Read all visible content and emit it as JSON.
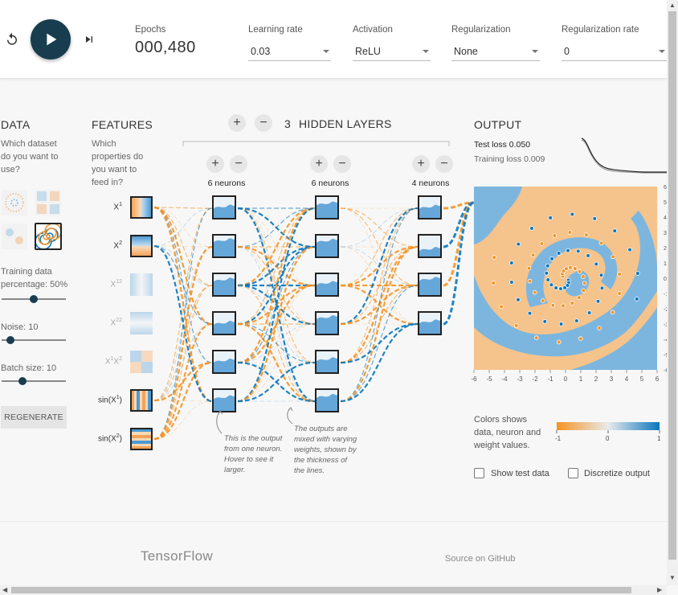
{
  "topbar": {
    "epochs_label": "Epochs",
    "epochs_value": "000,480",
    "learning_rate": {
      "label": "Learning rate",
      "value": "0.03"
    },
    "activation": {
      "label": "Activation",
      "value": "ReLU"
    },
    "regularization": {
      "label": "Regularization",
      "value": "None"
    },
    "regularization_rate": {
      "label": "Regularization rate",
      "value": "0"
    }
  },
  "data_panel": {
    "title": "DATA",
    "question": [
      "Which dataset",
      "do you want to",
      "use?"
    ],
    "training_ratio_label": "Training data",
    "training_ratio_value_label": "percentage:  50%",
    "training_ratio": 0.5,
    "noise_label": "Noise:  10",
    "noise": 0.2,
    "batch_label": "Batch size:  10",
    "batch": 0.3,
    "regenerate_label": "REGENERATE"
  },
  "features": {
    "title": "FEATURES",
    "question": [
      "Which",
      "properties do",
      "you want to",
      "feed in?"
    ],
    "items": [
      {
        "label": "X",
        "sup": "1",
        "active": true
      },
      {
        "label": "X",
        "sup": "2",
        "active": true
      },
      {
        "label": "X",
        "sup": "12",
        "active": false
      },
      {
        "label": "X",
        "sup": "22",
        "active": false
      },
      {
        "label": "X",
        "sup": "1",
        "label2": "X",
        "sup2": "2",
        "active": false
      },
      {
        "label": "sin(X",
        "sup": "1",
        "suffix": ")",
        "active": true
      },
      {
        "label": "sin(X",
        "sup": "2",
        "suffix": ")",
        "active": true
      }
    ]
  },
  "network": {
    "layer_count": "3",
    "hidden_layers_label": "HIDDEN LAYERS",
    "layers": [
      {
        "neurons_label": "6 neurons",
        "count": 6
      },
      {
        "neurons_label": "6 neurons",
        "count": 6
      },
      {
        "neurons_label": "4 neurons",
        "count": 4
      }
    ],
    "annotation_1": [
      "This is the output",
      "from one neuron.",
      "Hover to see it",
      "larger."
    ],
    "annotation_2": [
      "The outputs are",
      "mixed with varying",
      "weights, shown by",
      "the thickness of",
      "the lines."
    ]
  },
  "output": {
    "title": "OUTPUT",
    "test_loss_label": "Test loss",
    "test_loss": "0.050",
    "training_loss_label": "Training loss",
    "training_loss": "0.009",
    "x_ticks": [
      "-6",
      "-5",
      "-4",
      "-3",
      "-2",
      "-1",
      "0",
      "1",
      "2",
      "3",
      "4",
      "5",
      "6"
    ],
    "y_ticks": [
      "6",
      "5",
      "4",
      "3",
      "2",
      "1",
      "0",
      "-1",
      "-2",
      "-3",
      "-4",
      "-5",
      "-6"
    ],
    "legend_text": [
      "Colors shows",
      "data, neuron and",
      "weight values."
    ],
    "legend_min": "-1",
    "legend_mid": "0",
    "legend_max": "1",
    "show_test_label": "Show test data",
    "discretize_label": "Discretize output",
    "colors": {
      "orange": "#f59322",
      "blue": "#0877bd",
      "orange_bg": "#f5c38c",
      "blue_bg": "#7cb6df"
    }
  },
  "footer": {
    "brand": "TensorFlow",
    "source": "Source on GitHub"
  }
}
